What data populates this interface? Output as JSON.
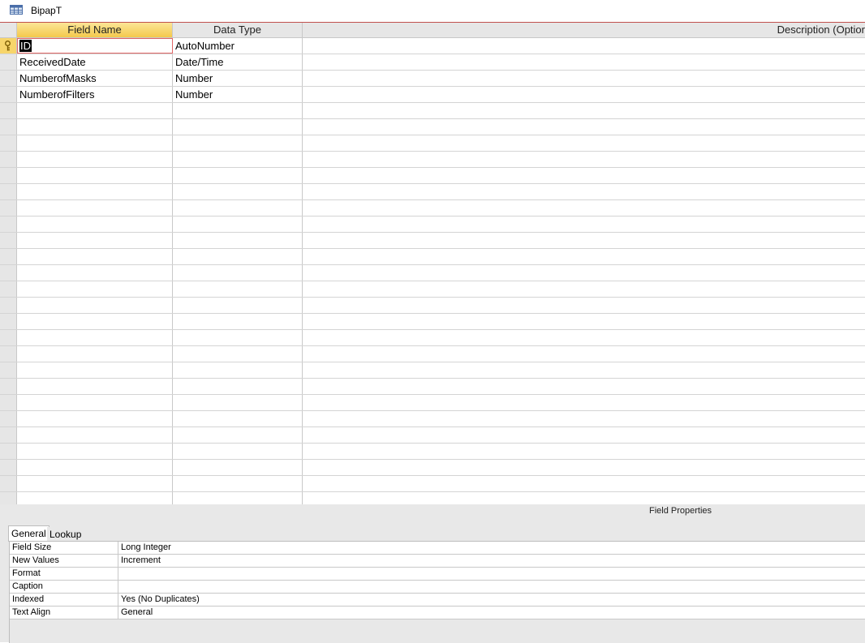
{
  "window": {
    "title": "BipapT",
    "icon": "table-icon"
  },
  "grid": {
    "headers": {
      "field_name": "Field Name",
      "data_type": "Data Type",
      "description": "Description (Optior"
    },
    "rows": [
      {
        "field_name": "ID",
        "data_type": "AutoNumber",
        "primary_key": true
      },
      {
        "field_name": "ReceivedDate",
        "data_type": "Date/Time"
      },
      {
        "field_name": "NumberofMasks",
        "data_type": "Number"
      },
      {
        "field_name": "NumberofFilters",
        "data_type": "Number"
      }
    ]
  },
  "properties": {
    "title": "Field Properties",
    "tabs": {
      "general": "General",
      "lookup": "Lookup"
    },
    "rows": [
      {
        "label": "Field Size",
        "value": "Long Integer"
      },
      {
        "label": "New Values",
        "value": "Increment"
      },
      {
        "label": "Format",
        "value": ""
      },
      {
        "label": "Caption",
        "value": ""
      },
      {
        "label": "Indexed",
        "value": "Yes (No Duplicates)"
      },
      {
        "label": "Text Align",
        "value": "General"
      }
    ]
  },
  "colors": {
    "selected_header": "#f7d56b",
    "accent_border": "#c0504d"
  }
}
